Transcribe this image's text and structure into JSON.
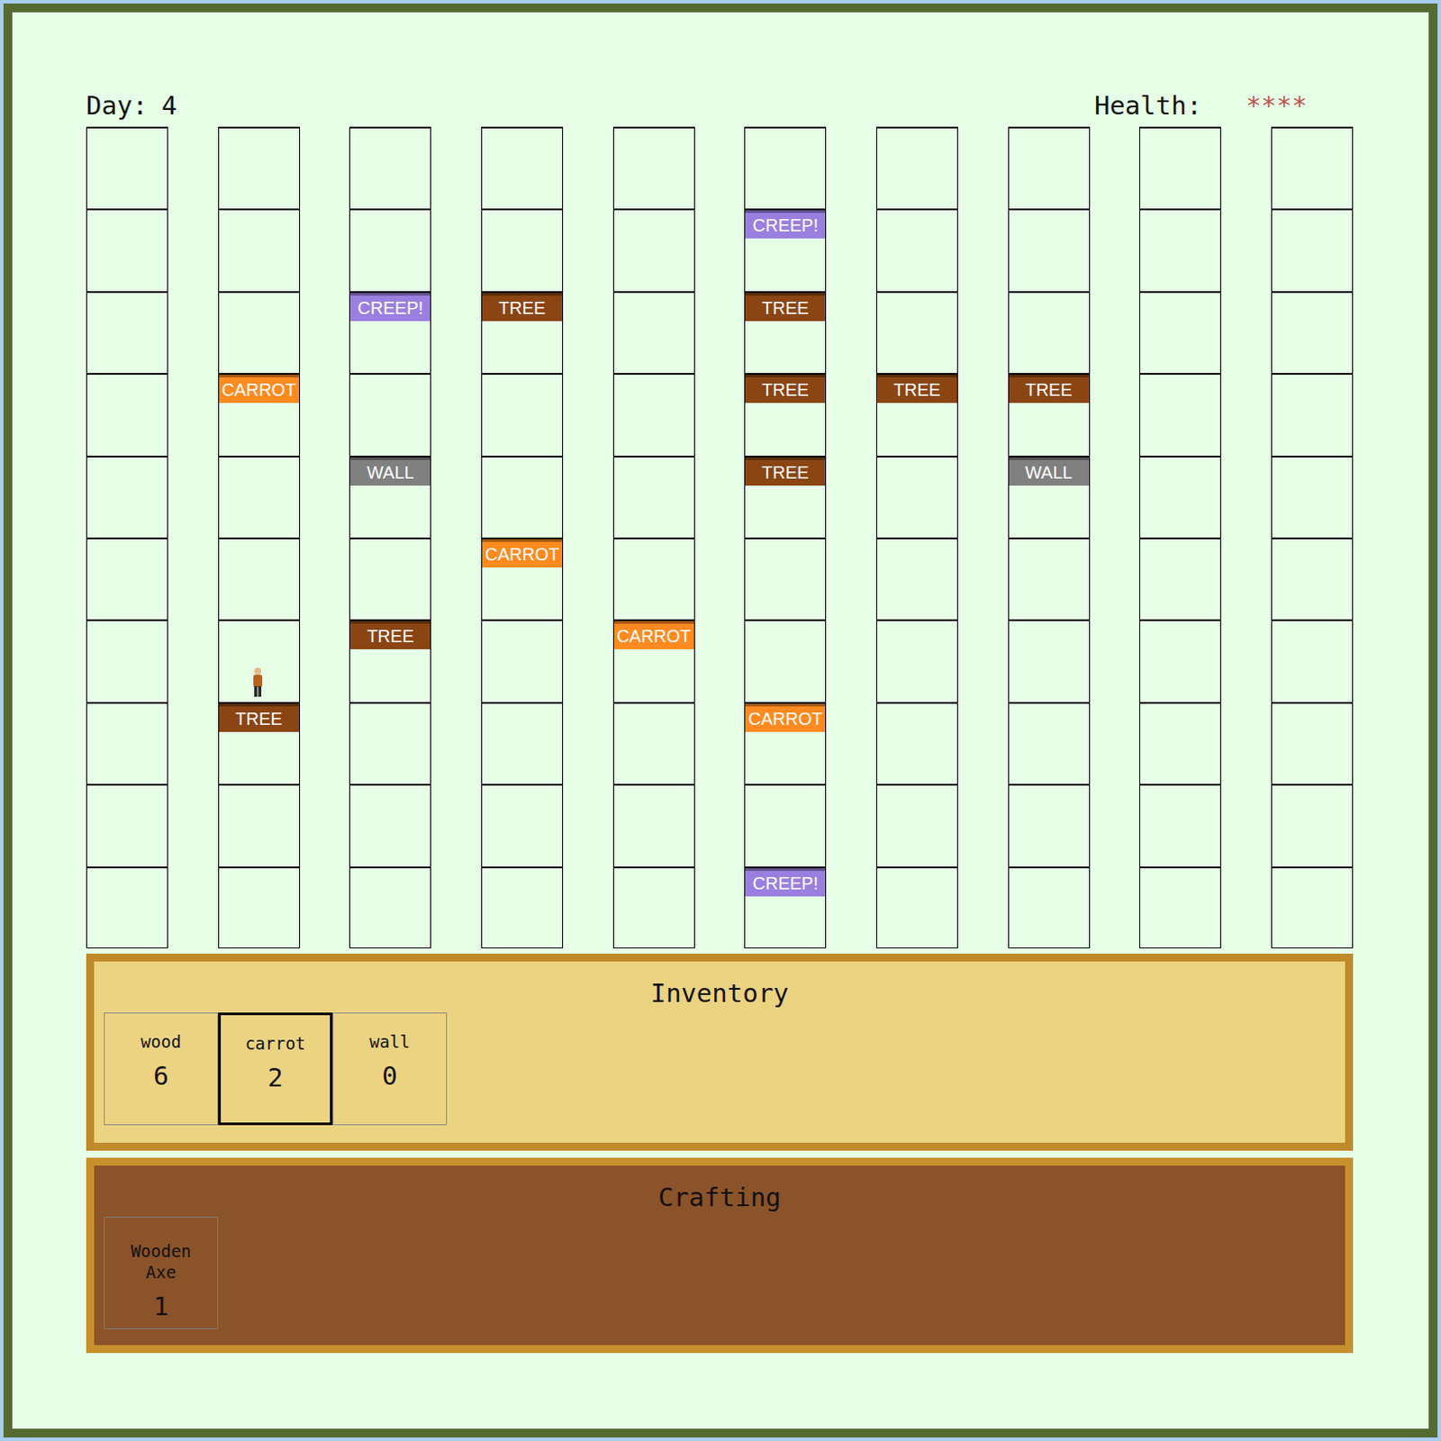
{
  "day": {
    "label": "Day:",
    "value": "4"
  },
  "health": {
    "label": "Health:",
    "value": "****"
  },
  "grid": {
    "rows": [
      [
        {
          "label": "",
          "color": "",
          "player": false
        },
        {
          "label": "",
          "color": "",
          "player": false
        },
        {
          "label": "",
          "color": "",
          "player": false
        },
        {
          "label": "",
          "color": "",
          "player": false
        },
        {
          "label": "",
          "color": "",
          "player": false
        },
        {
          "label": "",
          "color": "",
          "player": false
        },
        {
          "label": "",
          "color": "",
          "player": false
        },
        {
          "label": "",
          "color": "",
          "player": false
        },
        {
          "label": "",
          "color": "",
          "player": false
        },
        {
          "label": "",
          "color": "",
          "player": false
        }
      ],
      [
        {
          "label": "",
          "color": "",
          "player": false
        },
        {
          "label": "",
          "color": "",
          "player": false
        },
        {
          "label": "",
          "color": "",
          "player": false
        },
        {
          "label": "",
          "color": "",
          "player": false
        },
        {
          "label": "",
          "color": "",
          "player": false
        },
        {
          "label": "CREEP!",
          "color": "#9b7fe0",
          "player": false
        },
        {
          "label": "",
          "color": "",
          "player": false
        },
        {
          "label": "",
          "color": "",
          "player": false
        },
        {
          "label": "",
          "color": "",
          "player": false
        },
        {
          "label": "",
          "color": "",
          "player": false
        }
      ],
      [
        {
          "label": "",
          "color": "",
          "player": false
        },
        {
          "label": "",
          "color": "",
          "player": false
        },
        {
          "label": "CREEP!",
          "color": "#9b7fe0",
          "player": false
        },
        {
          "label": "TREE",
          "color": "#8b4513",
          "player": false
        },
        {
          "label": "",
          "color": "",
          "player": false
        },
        {
          "label": "TREE",
          "color": "#8b4513",
          "player": false
        },
        {
          "label": "",
          "color": "",
          "player": false
        },
        {
          "label": "",
          "color": "",
          "player": false
        },
        {
          "label": "",
          "color": "",
          "player": false
        },
        {
          "label": "",
          "color": "",
          "player": false
        }
      ],
      [
        {
          "label": "",
          "color": "",
          "player": false
        },
        {
          "label": "CARROT",
          "color": "#ff8a1f",
          "player": false
        },
        {
          "label": "",
          "color": "",
          "player": false
        },
        {
          "label": "",
          "color": "",
          "player": false
        },
        {
          "label": "",
          "color": "",
          "player": false
        },
        {
          "label": "TREE",
          "color": "#8b4513",
          "player": false
        },
        {
          "label": "TREE",
          "color": "#8b4513",
          "player": false
        },
        {
          "label": "TREE",
          "color": "#8b4513",
          "player": false
        },
        {
          "label": "",
          "color": "",
          "player": false
        },
        {
          "label": "",
          "color": "",
          "player": false
        }
      ],
      [
        {
          "label": "",
          "color": "",
          "player": false
        },
        {
          "label": "",
          "color": "",
          "player": false
        },
        {
          "label": "WALL",
          "color": "#808080",
          "player": false
        },
        {
          "label": "",
          "color": "",
          "player": false
        },
        {
          "label": "",
          "color": "",
          "player": false
        },
        {
          "label": "TREE",
          "color": "#8b4513",
          "player": false
        },
        {
          "label": "",
          "color": "",
          "player": false
        },
        {
          "label": "WALL",
          "color": "#808080",
          "player": false
        },
        {
          "label": "",
          "color": "",
          "player": false
        },
        {
          "label": "",
          "color": "",
          "player": false
        }
      ],
      [
        {
          "label": "",
          "color": "",
          "player": false
        },
        {
          "label": "",
          "color": "",
          "player": false
        },
        {
          "label": "",
          "color": "",
          "player": false
        },
        {
          "label": "CARROT",
          "color": "#ff8a1f",
          "player": false
        },
        {
          "label": "",
          "color": "",
          "player": false
        },
        {
          "label": "",
          "color": "",
          "player": false
        },
        {
          "label": "",
          "color": "",
          "player": false
        },
        {
          "label": "",
          "color": "",
          "player": false
        },
        {
          "label": "",
          "color": "",
          "player": false
        },
        {
          "label": "",
          "color": "",
          "player": false
        }
      ],
      [
        {
          "label": "",
          "color": "",
          "player": false
        },
        {
          "label": "",
          "color": "",
          "player": true
        },
        {
          "label": "TREE",
          "color": "#8b4513",
          "player": false
        },
        {
          "label": "",
          "color": "",
          "player": false
        },
        {
          "label": "CARROT",
          "color": "#ff8a1f",
          "player": false
        },
        {
          "label": "",
          "color": "",
          "player": false
        },
        {
          "label": "",
          "color": "",
          "player": false
        },
        {
          "label": "",
          "color": "",
          "player": false
        },
        {
          "label": "",
          "color": "",
          "player": false
        },
        {
          "label": "",
          "color": "",
          "player": false
        }
      ],
      [
        {
          "label": "",
          "color": "",
          "player": false
        },
        {
          "label": "TREE",
          "color": "#8b4513",
          "player": false
        },
        {
          "label": "",
          "color": "",
          "player": false
        },
        {
          "label": "",
          "color": "",
          "player": false
        },
        {
          "label": "",
          "color": "",
          "player": false
        },
        {
          "label": "CARROT",
          "color": "#ff8a1f",
          "player": false
        },
        {
          "label": "",
          "color": "",
          "player": false
        },
        {
          "label": "",
          "color": "",
          "player": false
        },
        {
          "label": "",
          "color": "",
          "player": false
        },
        {
          "label": "",
          "color": "",
          "player": false
        }
      ],
      [
        {
          "label": "",
          "color": "",
          "player": false
        },
        {
          "label": "",
          "color": "",
          "player": false
        },
        {
          "label": "",
          "color": "",
          "player": false
        },
        {
          "label": "",
          "color": "",
          "player": false
        },
        {
          "label": "",
          "color": "",
          "player": false
        },
        {
          "label": "",
          "color": "",
          "player": false
        },
        {
          "label": "",
          "color": "",
          "player": false
        },
        {
          "label": "",
          "color": "",
          "player": false
        },
        {
          "label": "",
          "color": "",
          "player": false
        },
        {
          "label": "",
          "color": "",
          "player": false
        }
      ],
      [
        {
          "label": "",
          "color": "",
          "player": false
        },
        {
          "label": "",
          "color": "",
          "player": false
        },
        {
          "label": "",
          "color": "",
          "player": false
        },
        {
          "label": "",
          "color": "",
          "player": false
        },
        {
          "label": "",
          "color": "",
          "player": false
        },
        {
          "label": "CREEP!",
          "color": "#9b7fe0",
          "player": false
        },
        {
          "label": "",
          "color": "",
          "player": false
        },
        {
          "label": "",
          "color": "",
          "player": false
        },
        {
          "label": "",
          "color": "",
          "player": false
        },
        {
          "label": "",
          "color": "",
          "player": false
        }
      ]
    ]
  },
  "inventory": {
    "title": "Inventory",
    "items": [
      {
        "name": "wood",
        "count": "6",
        "selected": false
      },
      {
        "name": "carrot",
        "count": "2",
        "selected": true
      },
      {
        "name": "wall",
        "count": "0",
        "selected": false
      }
    ]
  },
  "crafting": {
    "title": "Crafting",
    "items": [
      {
        "name": "Wooden Axe",
        "count": "1"
      }
    ]
  }
}
